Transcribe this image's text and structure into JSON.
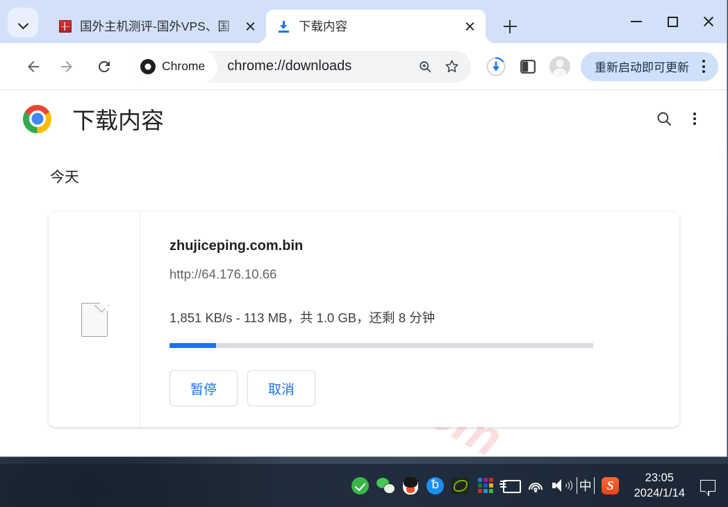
{
  "browser": {
    "tabs": [
      {
        "title": "国外主机测评-国外VPS、国",
        "favicon": "site-favicon",
        "active": false
      },
      {
        "title": "下载内容",
        "favicon": "download-icon",
        "active": true
      }
    ],
    "toolbar": {
      "back_icon": "arrow-left-icon",
      "forward_icon": "arrow-right-icon",
      "reload_icon": "reload-icon",
      "chrome_chip_label": "Chrome",
      "url": "chrome://downloads",
      "zoom_icon": "zoom-in-icon",
      "bookmark_icon": "star-icon",
      "download_icon": "download-progress-icon",
      "side_panel_icon": "side-panel-icon",
      "avatar_icon": "profile-avatar",
      "update_button_label": "重新启动即可更新",
      "menu_icon": "kebab-menu-icon"
    },
    "window_controls": {
      "minimize": "minimize-icon",
      "maximize": "maximize-icon",
      "close": "close-icon"
    },
    "new_tab_label": "+",
    "tab_search_icon": "chevron-down-icon"
  },
  "page": {
    "title": "下载内容",
    "logo": "chrome-logo",
    "search_icon": "search-icon",
    "menu_icon": "kebab-menu-icon",
    "group_label": "今天",
    "watermark": "zhujiceping.com",
    "download": {
      "file_icon": "generic-file-icon",
      "file_name": "zhujiceping.com.bin",
      "url": "http://64.176.10.66",
      "status": "1,851 KB/s - 113 MB，共 1.0 GB，还剩 8 分钟",
      "progress_percent": 11,
      "progress_color": "#1a73e8",
      "actions": [
        {
          "label": "暂停",
          "name": "pause-button"
        },
        {
          "label": "取消",
          "name": "cancel-button"
        }
      ]
    }
  },
  "taskbar": {
    "tray_icons": [
      "security-check-icon",
      "wechat-icon",
      "qq-icon",
      "bluetooth-icon",
      "nvidia-icon",
      "app-grid-icon",
      "battery-icon",
      "wifi-icon",
      "volume-icon",
      "ime-chinese-icon",
      "sogou-input-icon"
    ],
    "ime_label": "中",
    "sogou_label": "S",
    "clock": {
      "time": "23:05",
      "date": "2024/1/14"
    },
    "notification_icon": "notification-bubble-icon"
  },
  "colors": {
    "tab_strip_bg": "#d2e1f8",
    "accent_blue": "#1a73e8",
    "update_chip_bg": "#cfe0fb",
    "watermark_pink": "#fbdfe0"
  }
}
